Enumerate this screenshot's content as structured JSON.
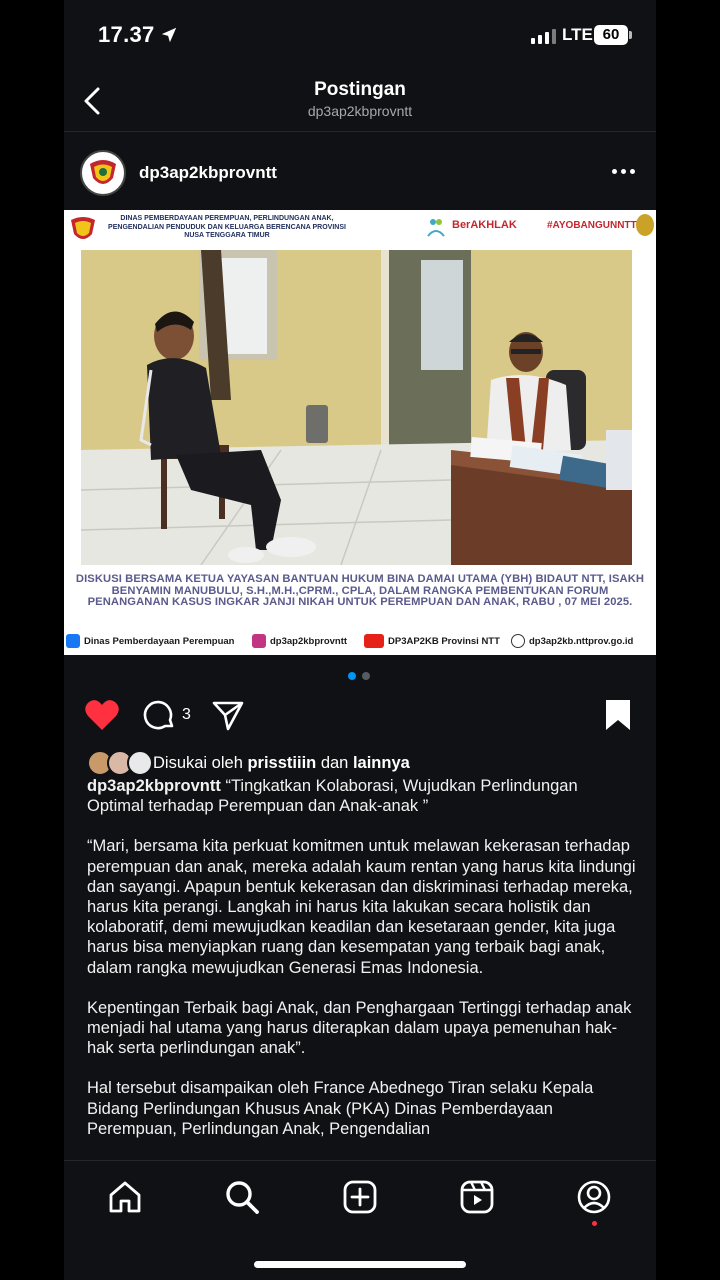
{
  "status_bar": {
    "time": "17.37",
    "network": "LTE",
    "battery": "60"
  },
  "header": {
    "title": "Postingan",
    "subtitle": "dp3ap2kbprovntt"
  },
  "post": {
    "author": "dp3ap2kbprovntt",
    "image": {
      "agency_name": "DINAS PEMBERDAYAAN PEREMPUAN, PERLINDUNGAN ANAK, PENGENDALIAN PENDUDUK DAN KELUARGA BERENCANA PROVINSI NUSA TENGGARA TIMUR",
      "berakhlak": "BerAKHLAK",
      "hashtag": "#AYOBANGUNNTT",
      "caption": "DISKUSI BERSAMA KETUA YAYASAN BANTUAN HUKUM BINA DAMAI UTAMA (YBH) BIDAUT NTT, ISAKH BENYAMIN MANUBULU, S.H.,M.H.,CPRM., CPLA, DALAM RANGKA PEMBENTUKAN FORUM PENANGANAN KASUS INGKAR JANJI NIKAH UNTUK PEREMPUAN DAN ANAK, RABU , 07 MEI 2025.",
      "footer": {
        "facebook": "Dinas Pemberdayaan Perempuan",
        "instagram": "dp3ap2kbprovntt",
        "youtube": "DP3AP2KB Provinsi NTT",
        "website": "dp3ap2kb.nttprov.go.id"
      }
    },
    "comment_count": "3",
    "likes": {
      "prefix": "Disukai oleh ",
      "user": "prisstiiin",
      "middle": " dan ",
      "others": "lainnya"
    },
    "caption_author": "dp3ap2kbprovntt",
    "caption_headline": " “Tingkatkan Kolaborasi, Wujudkan Perlindungan Optimal terhadap Perempuan dan Anak-anak ”",
    "paragraphs": [
      "“Mari, bersama kita perkuat komitmen untuk melawan kekerasan terhadap perempuan dan anak, mereka adalah kaum rentan yang harus kita lindungi dan sayangi. Apapun bentuk kekerasan dan diskriminasi terhadap mereka, harus kita perangi. Langkah ini harus kita lakukan secara holistik dan kolaboratif, demi mewujudkan keadilan dan kesetaraan gender, kita juga harus bisa menyiapkan ruang dan kesempatan yang terbaik bagi anak, dalam rangka mewujudkan Generasi Emas Indonesia.",
      "Kepentingan Terbaik bagi Anak, dan Penghargaan Tertinggi terhadap anak menjadi hal utama yang harus diterapkan dalam upaya pemenuhan hak-hak serta perlindungan anak”.",
      "Hal tersebut disampaikan oleh France Abednego Tiran selaku Kepala Bidang Perlindungan Khusus Anak (PKA) Dinas Pemberdayaan Perempuan, Perlindungan Anak, Pengendalian"
    ]
  },
  "colors": {
    "background": "#0f1114",
    "like": "#ff3040",
    "dot_active": "#0095f6",
    "dot_inactive": "#555b63"
  },
  "bottom_nav": [
    "home-icon",
    "search-icon",
    "create-icon",
    "reels-icon",
    "profile-icon"
  ]
}
